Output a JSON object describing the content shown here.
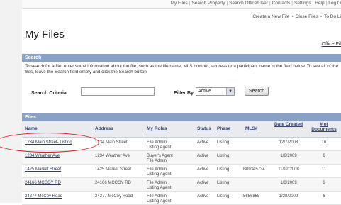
{
  "nav": {
    "items": [
      "My Files",
      "Search Property",
      "Search Office/User",
      "Contacts",
      "Settings",
      "Help",
      "Log O"
    ]
  },
  "actions": {
    "create": "Create a New File",
    "close": "Close Files",
    "todo": "To Do Li"
  },
  "page": {
    "title": "My Files",
    "office_link": "Office Fil"
  },
  "search": {
    "section_title": "Search",
    "instructions": "To search for a file, enter some information about the file, such as the file name, MLS number, address or a participant name in the field below.  To see all of the files, leave the Search field empty and click the Search button.",
    "criteria_label": "Search Criteria:",
    "criteria_value": "",
    "filter_label": "Filter By:",
    "filter_value": "Active",
    "button_label": "Search"
  },
  "files": {
    "section_title": "Files",
    "columns": {
      "name": "Name",
      "address": "Address",
      "roles": "My Roles",
      "status": "Status",
      "phase": "Phase",
      "mls": "MLS#",
      "date_created": "Date Created",
      "docs": "# of Documents"
    },
    "rows": [
      {
        "name": "1234 Main Street- Listing",
        "address": "1234 Main Street",
        "roles": "File Admin\nListing Agent",
        "status": "Active",
        "phase": "Listing",
        "mls": "",
        "date": "12/7/2008",
        "docs": "16"
      },
      {
        "name": "1234 Weather Ave",
        "address": "1234 Weather Ave",
        "roles": "Buyer's Agent\nFile Admin",
        "status": "Active",
        "phase": "Listing",
        "mls": "",
        "date": "1/6/2009",
        "docs": "6"
      },
      {
        "name": "1425 Market Street",
        "address": "1425 Market Street",
        "roles": "File Admin\nListing Agent",
        "status": "Active",
        "phase": "Listing",
        "mls": "B09345734",
        "date": "11/12/2008",
        "docs": "11"
      },
      {
        "name": "24166 MCCOY RD",
        "address": "24166 MCCOY RD",
        "roles": "File Admin\nListing Agent",
        "status": "Active",
        "phase": "Listing",
        "mls": "",
        "date": "1/6/2009",
        "docs": "6"
      },
      {
        "name": "24277 McCoy Road",
        "address": "24277 McCoy Road",
        "roles": "File Admin\nListing Agent",
        "status": "Active",
        "phase": "Listing",
        "mls": "5656865",
        "date": "1/28/2009",
        "docs": "6"
      }
    ]
  }
}
